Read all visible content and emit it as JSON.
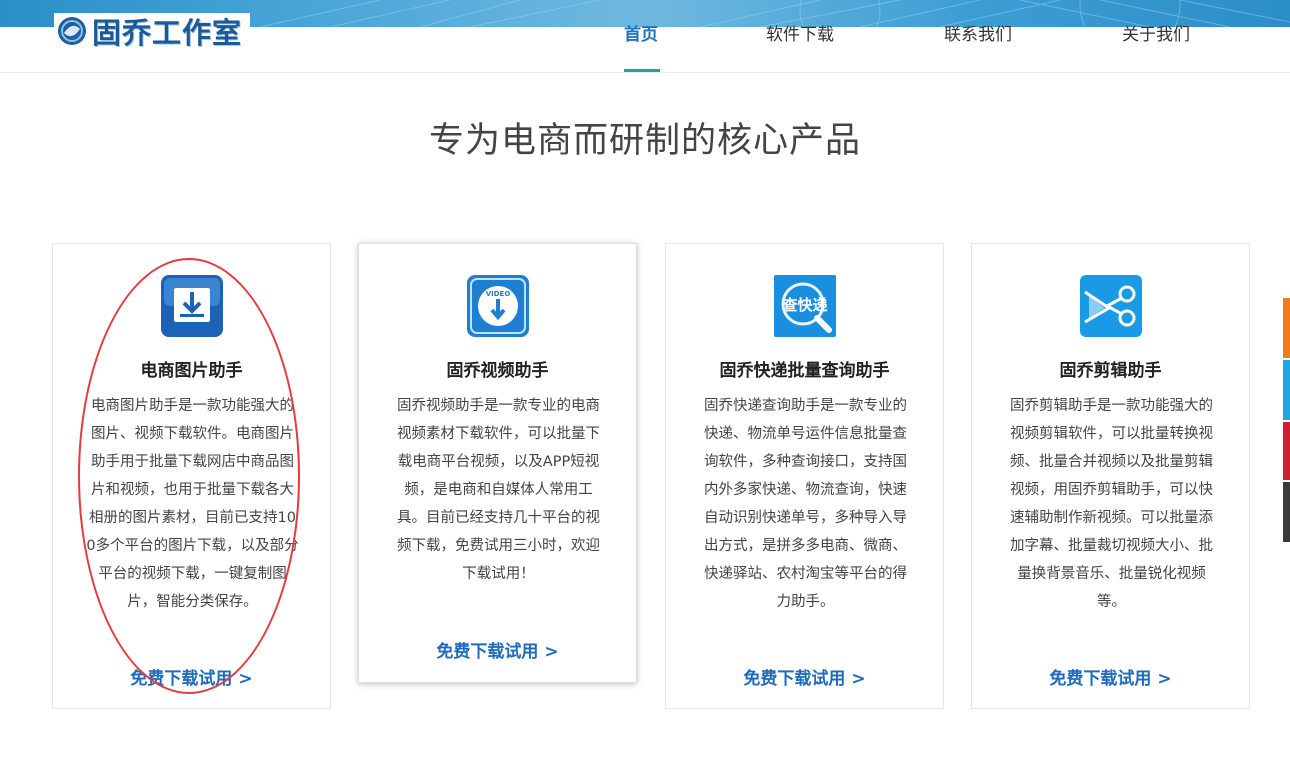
{
  "header": {
    "logo_text": "固乔工作室",
    "nav": [
      {
        "label": "首页",
        "active": true
      },
      {
        "label": "软件下载",
        "active": false
      },
      {
        "label": "联系我们",
        "active": false
      },
      {
        "label": "关于我们",
        "active": false
      }
    ]
  },
  "main": {
    "title": "专为电商而研制的核心产品",
    "cards": [
      {
        "icon": "download-icon",
        "title": "电商图片助手",
        "description": "电商图片助手是一款功能强大的图片、视频下载软件。电商图片助手用于批量下载网店中商品图片和视频，也用于批量下载各大相册的图片素材，目前已支持100多个平台的图片下载，以及部分平台的视频下载，一键复制图片，智能分类保存。",
        "link": "免费下载试用 >"
      },
      {
        "icon": "video-download-icon",
        "icon_label": "VIDEO",
        "title": "固乔视频助手",
        "description": "固乔视频助手是一款专业的电商视频素材下载软件，可以批量下载电商平台视频，以及APP短视频，是电商和自媒体人常用工具。目前已经支持几十平台的视频下载，免费试用三小时，欢迎下载试用！",
        "link": "免费下载试用 >"
      },
      {
        "icon": "express-search-icon",
        "icon_label": "查快递",
        "title": "固乔快递批量查询助手",
        "description": "固乔快递查询助手是一款专业的快递、物流单号运件信息批量查询软件，多种查询接口，支持国内外多家快递、物流查询，快速自动识别快递单号，多种导入导出方式，是拼多多电商、微商、快递驿站、农村淘宝等平台的得力助手。",
        "link": "免费下载试用 >"
      },
      {
        "icon": "scissors-icon",
        "title": "固乔剪辑助手",
        "description": "固乔剪辑助手是一款功能强大的视频剪辑软件，可以批量转换视频、批量合并视频以及批量剪辑视频，用固乔剪辑助手，可以快速辅助制作新视频。可以批量添加字幕、批量裁切视频大小、批量换背景音乐、批量锐化视频等。",
        "link": "免费下载试用 >"
      }
    ]
  },
  "colors": {
    "accent": "#1e73be",
    "link": "#1e6bbd",
    "annotation": "#e8393c",
    "side_strip": [
      "#f07c1b",
      "#1fa6e0",
      "#d0202f",
      "#3a3a3a"
    ]
  }
}
